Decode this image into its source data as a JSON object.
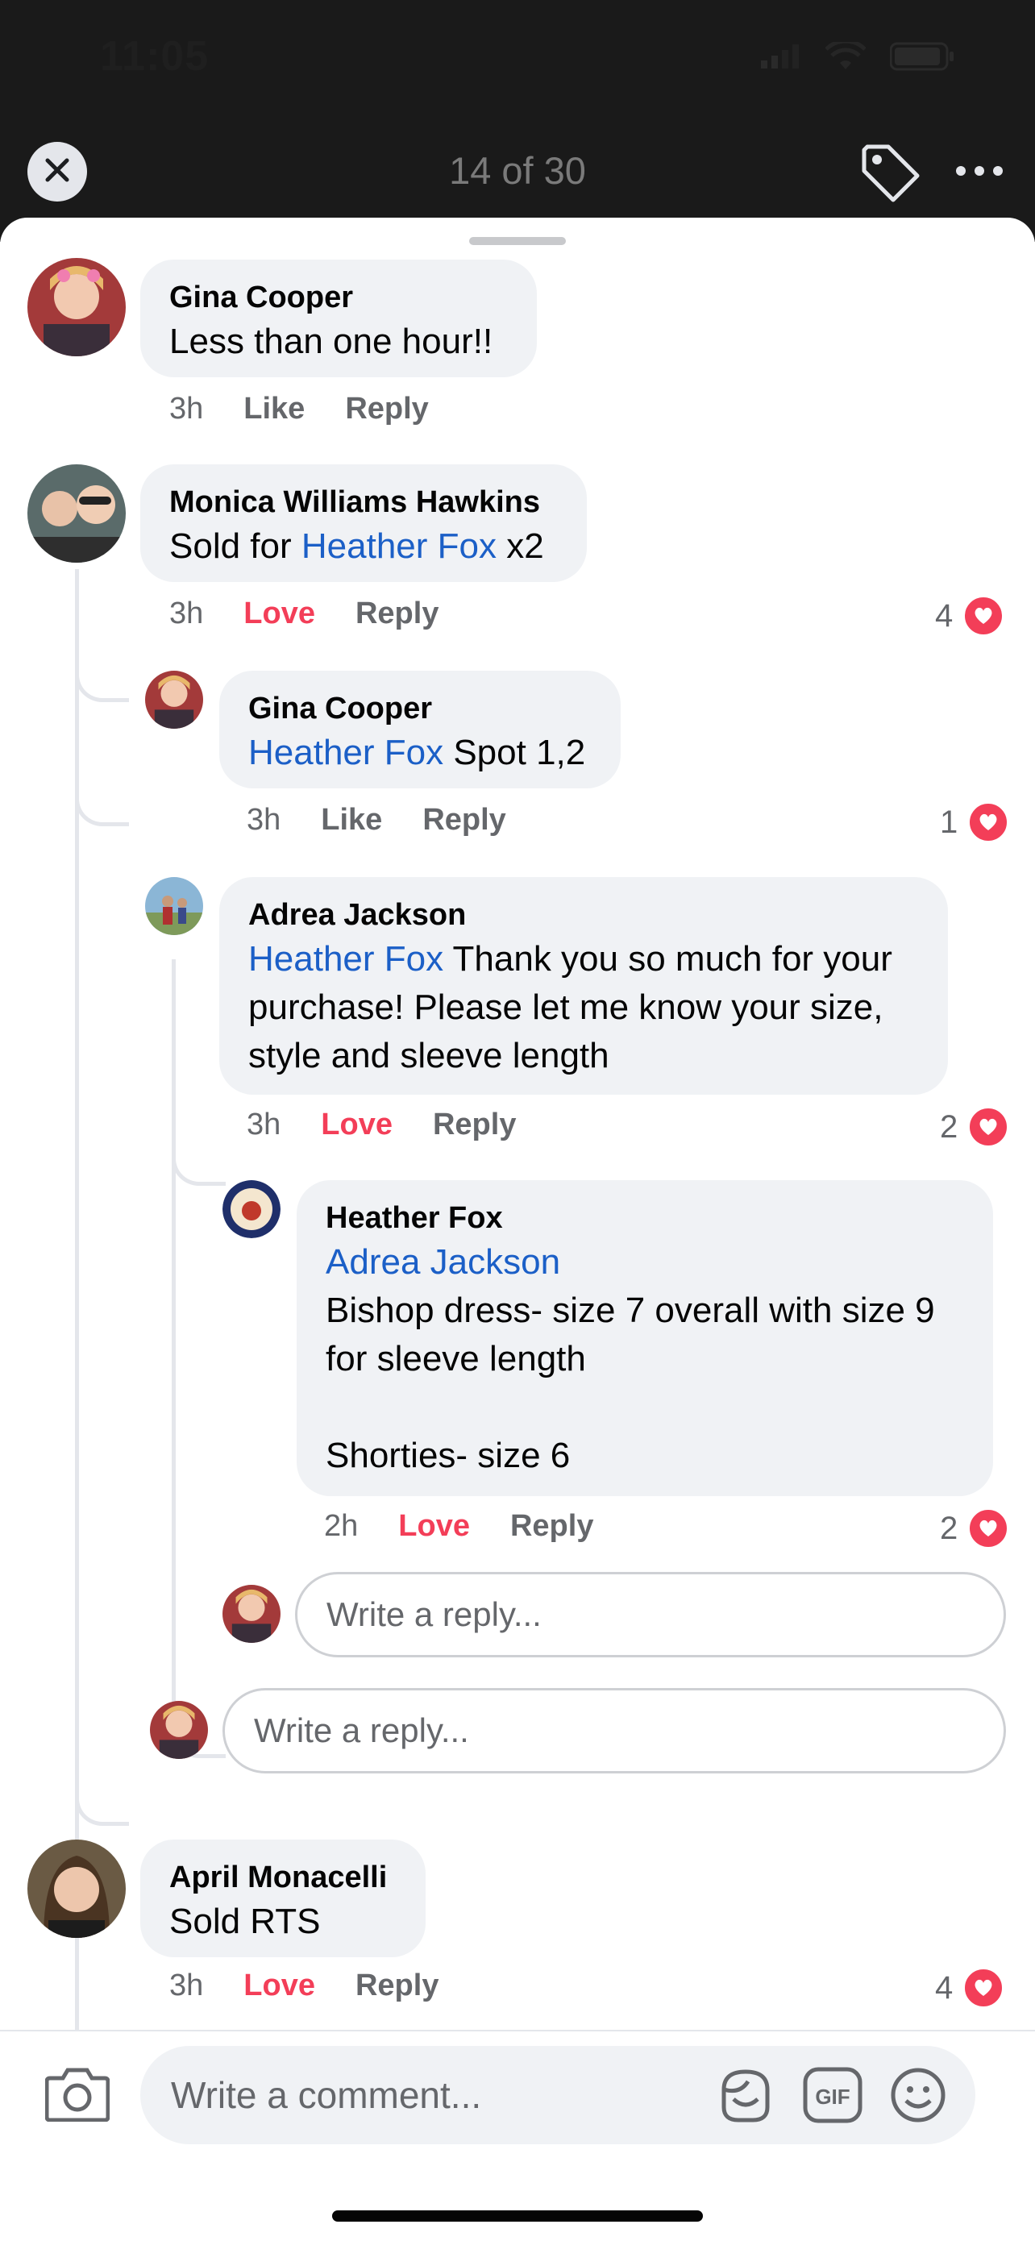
{
  "status": {
    "time": "11:05"
  },
  "header": {
    "counter": "14 of 30"
  },
  "comments": [
    {
      "name": "Gina Cooper",
      "text": "Less than one hour!!",
      "time": "3h",
      "action": "Like",
      "reply": "Reply"
    },
    {
      "name": "Monica Williams Hawkins",
      "pre": "Sold for ",
      "mention": "Heather Fox",
      "post": " x2",
      "time": "3h",
      "action": "Love",
      "reply": "Reply",
      "count": "4"
    },
    {
      "name": "Gina Cooper",
      "mention": "Heather Fox",
      "post": " Spot 1,2",
      "time": "3h",
      "action": "Like",
      "reply": "Reply",
      "count": "1"
    },
    {
      "name": "Adrea Jackson",
      "mention": "Heather Fox",
      "post": " Thank you so much for your purchase! Please let me know your size, style and sleeve length",
      "time": "3h",
      "action": "Love",
      "reply": "Reply",
      "count": "2"
    },
    {
      "name": "Heather Fox",
      "mention": "Adrea Jackson",
      "post": "Bishop dress- size 7 overall with size 9 for sleeve length\n\nShorties- size 6",
      "time": "2h",
      "action": "Love",
      "reply": "Reply",
      "count": "2"
    },
    {
      "name": "April Monacelli",
      "text": "Sold RTS",
      "time": "3h",
      "action": "Love",
      "reply": "Reply",
      "count": "4"
    }
  ],
  "reply_placeholder": "Write a reply...",
  "comment_placeholder": "Write a comment...",
  "colors": {
    "mention": "#1b5fc7",
    "love": "#f33e58",
    "bubble": "#f0f2f5"
  }
}
